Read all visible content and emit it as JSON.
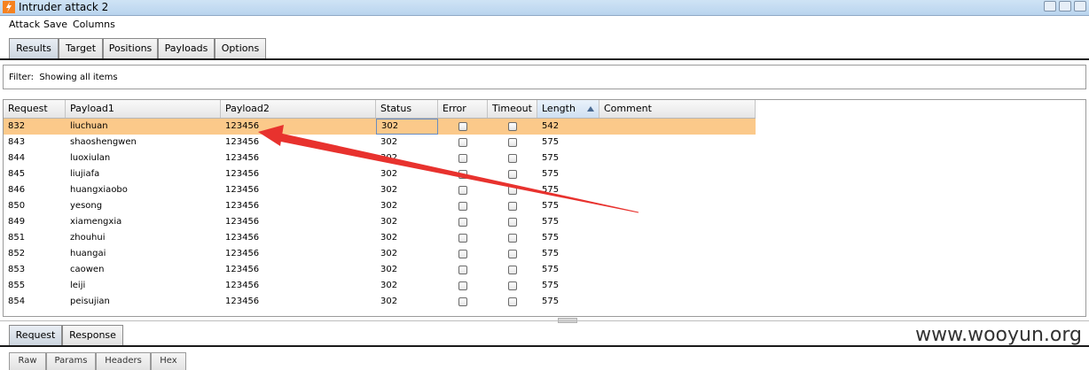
{
  "window": {
    "title": "Intruder attack 2"
  },
  "menu": [
    "Attack",
    "Save",
    "Columns"
  ],
  "tabs": [
    "Results",
    "Target",
    "Positions",
    "Payloads",
    "Options"
  ],
  "filter": {
    "label": "Filter:",
    "value": "Showing all items"
  },
  "table": {
    "columns": [
      "Request",
      "Payload1",
      "Payload2",
      "Status",
      "Error",
      "Timeout",
      "Length",
      "Comment"
    ],
    "sorted_column": "Length",
    "rows": [
      {
        "request": "832",
        "payload1": "liuchuan",
        "payload2": "123456",
        "status": "302",
        "error": false,
        "timeout": false,
        "length": "542",
        "comment": ""
      },
      {
        "request": "843",
        "payload1": "shaoshengwen",
        "payload2": "123456",
        "status": "302",
        "error": false,
        "timeout": false,
        "length": "575",
        "comment": ""
      },
      {
        "request": "844",
        "payload1": "luoxiulan",
        "payload2": "123456",
        "status": "302",
        "error": false,
        "timeout": false,
        "length": "575",
        "comment": ""
      },
      {
        "request": "845",
        "payload1": "liujiafa",
        "payload2": "123456",
        "status": "302",
        "error": false,
        "timeout": false,
        "length": "575",
        "comment": ""
      },
      {
        "request": "846",
        "payload1": "huangxiaobo",
        "payload2": "123456",
        "status": "302",
        "error": false,
        "timeout": false,
        "length": "575",
        "comment": ""
      },
      {
        "request": "850",
        "payload1": "yesong",
        "payload2": "123456",
        "status": "302",
        "error": false,
        "timeout": false,
        "length": "575",
        "comment": ""
      },
      {
        "request": "849",
        "payload1": "xiamengxia",
        "payload2": "123456",
        "status": "302",
        "error": false,
        "timeout": false,
        "length": "575",
        "comment": ""
      },
      {
        "request": "851",
        "payload1": "zhouhui",
        "payload2": "123456",
        "status": "302",
        "error": false,
        "timeout": false,
        "length": "575",
        "comment": ""
      },
      {
        "request": "852",
        "payload1": "huangai",
        "payload2": "123456",
        "status": "302",
        "error": false,
        "timeout": false,
        "length": "575",
        "comment": ""
      },
      {
        "request": "853",
        "payload1": "caowen",
        "payload2": "123456",
        "status": "302",
        "error": false,
        "timeout": false,
        "length": "575",
        "comment": ""
      },
      {
        "request": "855",
        "payload1": "leiji",
        "payload2": "123456",
        "status": "302",
        "error": false,
        "timeout": false,
        "length": "575",
        "comment": ""
      },
      {
        "request": "854",
        "payload1": "peisujian",
        "payload2": "123456",
        "status": "302",
        "error": false,
        "timeout": false,
        "length": "575",
        "comment": ""
      }
    ]
  },
  "bottom_tabs": [
    "Request",
    "Response"
  ],
  "sub_tabs": [
    "Raw",
    "Params",
    "Headers",
    "Hex"
  ],
  "watermark": "www.wooyun.org",
  "colors": {
    "selected_row": "#fbc98a",
    "annotation_arrow": "#e8322e",
    "title_bar": "#c4dbf1"
  },
  "icons": [
    "burp-app-icon",
    "minimize-icon",
    "maximize-icon",
    "close-icon",
    "sort-ascending-icon",
    "checkbox-icon",
    "red-annotation-arrow"
  ]
}
